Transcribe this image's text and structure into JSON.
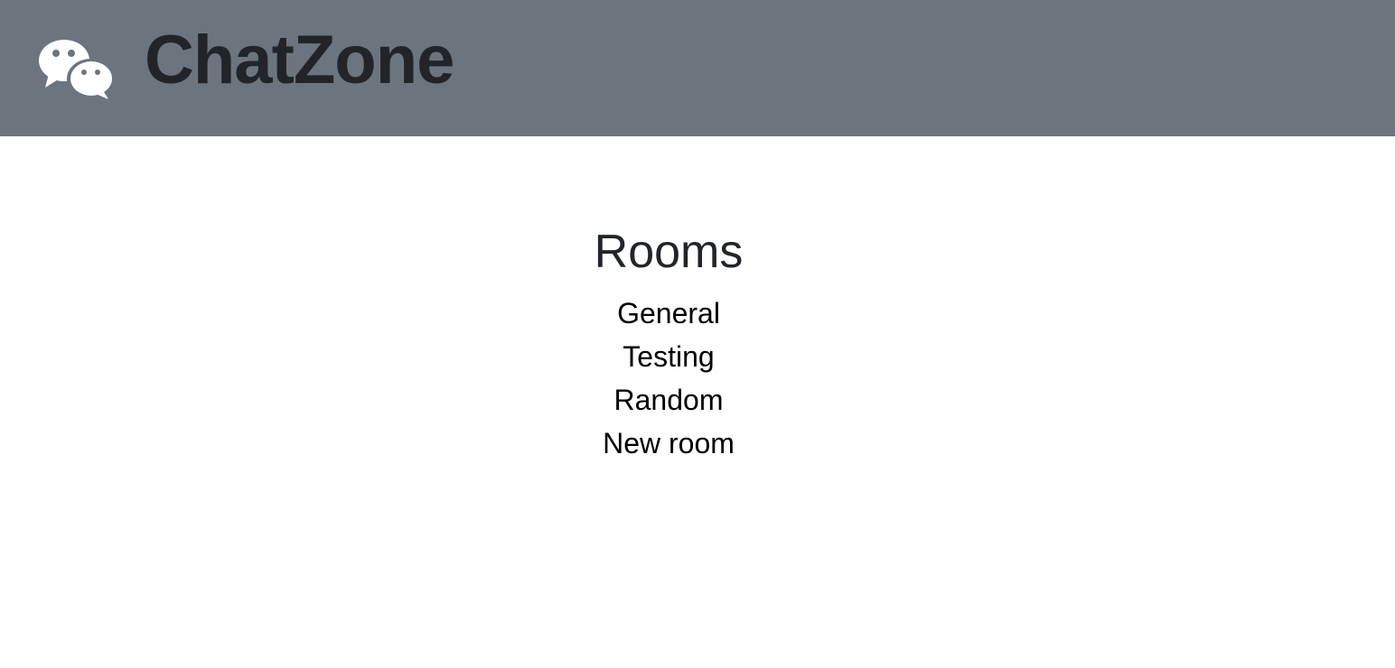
{
  "header": {
    "brand": "ChatZone",
    "logo_icon": "chat-bubbles-icon",
    "background_color": "#6c757d",
    "brand_color": "#212529"
  },
  "rooms": {
    "title": "Rooms",
    "items": [
      {
        "label": "General"
      },
      {
        "label": "Testing"
      },
      {
        "label": "Random"
      },
      {
        "label": "New room"
      }
    ]
  }
}
